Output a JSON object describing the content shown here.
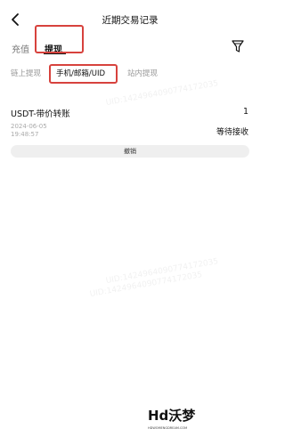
{
  "header": {
    "title": "近期交易记录",
    "back_icon": "back-arrow-icon"
  },
  "tabs": [
    {
      "label": "充值",
      "active": false
    },
    {
      "label": "提现",
      "active": true
    }
  ],
  "filter_icon": "filter-funnel-icon",
  "subtabs": [
    {
      "label": "链上提现",
      "active": false
    },
    {
      "label": "手机/邮箱/UID",
      "active": true
    },
    {
      "label": "站内提现",
      "active": false
    }
  ],
  "record": {
    "name": "USDT-带价转账",
    "amount": "1",
    "date": "2024-06-05",
    "time": "19:48:57",
    "status": "等待接收",
    "cancel_label": "撤销"
  },
  "watermark": "UID:1424964090774172035",
  "highlight_color": "#d7423d",
  "logo": {
    "mark": "Hd沃梦",
    "sub": "HDWOMENGDREAM.COM"
  }
}
